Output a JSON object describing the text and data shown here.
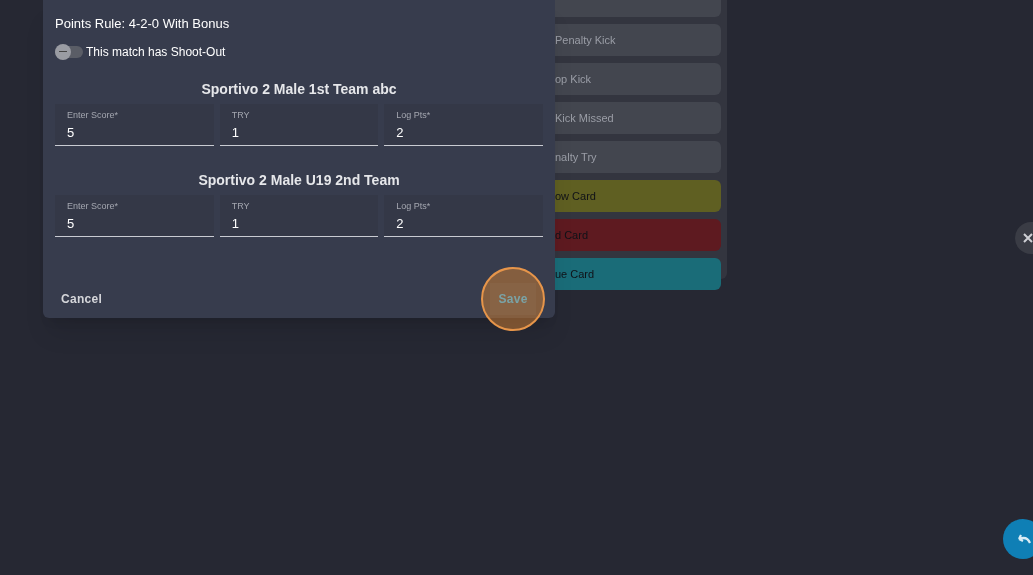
{
  "background_panel": {
    "items": [
      {
        "label": "Penalty Kick",
        "kind": "plain"
      },
      {
        "label": "op Kick",
        "kind": "plain"
      },
      {
        "label": "Kick Missed",
        "kind": "plain"
      },
      {
        "label": "nalty Try",
        "kind": "plain"
      },
      {
        "label": "ow Card",
        "kind": "yellow"
      },
      {
        "label": "d Card",
        "kind": "red"
      },
      {
        "label": "ue Card",
        "kind": "blue"
      }
    ]
  },
  "dialog": {
    "points_rule": "Points Rule: 4-2-0 With Bonus",
    "shootout": {
      "label": "This match has Shoot-Out",
      "on": false
    },
    "teams": [
      {
        "name": "Sportivo 2 Male 1st Team abc",
        "fields": [
          {
            "label": "Enter Score*",
            "value": "5"
          },
          {
            "label": "TRY",
            "value": "1"
          },
          {
            "label": "Log Pts*",
            "value": "2"
          }
        ]
      },
      {
        "name": "Sportivo 2 Male U19 2nd Team",
        "fields": [
          {
            "label": "Enter Score*",
            "value": "5"
          },
          {
            "label": "TRY",
            "value": "1"
          },
          {
            "label": "Log Pts*",
            "value": "2"
          }
        ]
      }
    ],
    "cancel": "Cancel",
    "save": {
      "label": "Save",
      "disabled": true,
      "highlighted": true
    }
  }
}
